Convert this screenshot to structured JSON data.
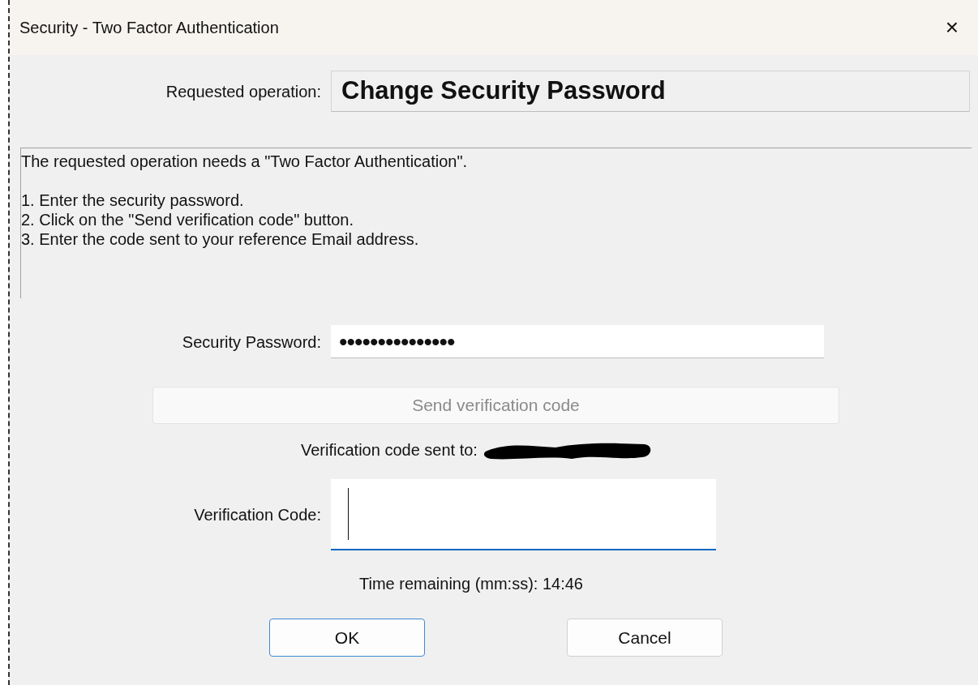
{
  "window": {
    "title": "Security - Two Factor Authentication",
    "close": "×"
  },
  "operation": {
    "label": "Requested operation:",
    "value": "Change Security Password"
  },
  "info": {
    "intro": "The requested operation needs a \"Two Factor Authentication\".",
    "steps": [
      "1. Enter the security password.",
      "2. Click on the \"Send verification code\" button.",
      "3. Enter the code sent to your reference Email address."
    ]
  },
  "password": {
    "label": "Security Password:",
    "value": "•••••••••••••••"
  },
  "send_button": {
    "label": "Send verification code",
    "disabled": true
  },
  "sent_to": {
    "label": "Verification code sent to:",
    "redacted": true
  },
  "code": {
    "label": "Verification Code:",
    "focused": true
  },
  "timer": "Time remaining (mm:ss): 14:46",
  "buttons": [
    {
      "label": "OK",
      "default": true
    },
    {
      "label": "Cancel",
      "default": false
    }
  ]
}
